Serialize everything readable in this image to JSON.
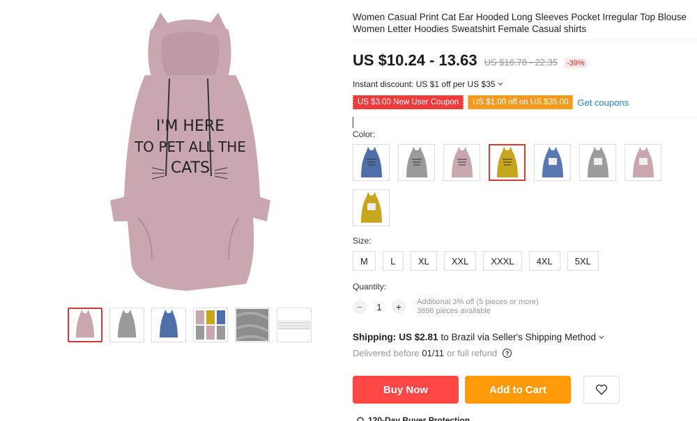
{
  "product": {
    "title": "Women Casual Print Cat Ear Hooded Long Sleeves Pocket Irregular Top Blouse Women Letter Hoodies Sweatshirt Female Casual shirts",
    "print_text": [
      "I'M HERE",
      "TO PET ALL THE",
      "CATS"
    ],
    "price": "US $10.24 - 13.63",
    "old_price": "US $16.78 - 22.35",
    "discount": "-39%",
    "instant_discount": "Instant discount: US $1 off per US $35",
    "coupons": [
      "US $3.00 New User Coupon",
      "US $1.00 off on US $35.00"
    ],
    "get_coupons": "Get coupons"
  },
  "colors": {
    "label": "Color:",
    "swatches": [
      {
        "name": "blue",
        "hex": "#4f6fa8"
      },
      {
        "name": "gray",
        "hex": "#9a9a9a"
      },
      {
        "name": "pink",
        "hex": "#c9a7ae"
      },
      {
        "name": "yellow",
        "hex": "#c6a51f"
      },
      {
        "name": "blue-cat",
        "hex": "#5778b2"
      },
      {
        "name": "gray-cat",
        "hex": "#9c9c9c"
      },
      {
        "name": "pink-cat",
        "hex": "#c9a7ae"
      },
      {
        "name": "yellow-cat",
        "hex": "#c6a51f"
      }
    ],
    "selected_index": 3
  },
  "sizes": {
    "label": "Size:",
    "options": [
      "M",
      "L",
      "XL",
      "XXL",
      "XXXL",
      "4XL",
      "5XL"
    ]
  },
  "quantity": {
    "label": "Quantity:",
    "value": "1",
    "minus": "−",
    "plus": "+",
    "info_1": "Additional 3% off (5 pieces or more)",
    "info_2": "3696 pieces available"
  },
  "shipping": {
    "prefix": "Shipping:",
    "amount": "US $2.81",
    "suffix": "to Brazil via Seller's Shipping Method",
    "delivered_prefix": "Delivered before",
    "delivered_date": "01/11",
    "delivered_suffix": "or full refund"
  },
  "actions": {
    "buy_now": "Buy Now",
    "add_to_cart": "Add to Cart"
  },
  "protection": "120-Day Buyer Protection",
  "colors_theme": {
    "accent_red": "#ff4747",
    "accent_orange": "#ff9a0a",
    "link_blue": "#2a7fc6",
    "hoodie_pink": "#c9a7ae"
  }
}
